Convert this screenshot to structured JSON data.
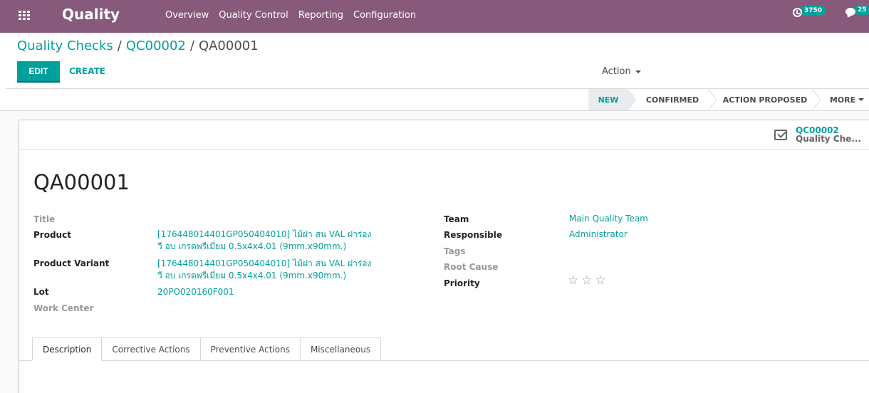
{
  "nav": {
    "brand": "Quality",
    "menu": [
      "Overview",
      "Quality Control",
      "Reporting",
      "Configuration"
    ],
    "activity_count": "3750",
    "message_count": "25"
  },
  "breadcrumb": {
    "root": "Quality Checks",
    "parent": "QC00002",
    "current": "QA00001"
  },
  "buttons": {
    "edit": "EDIT",
    "create": "CREATE",
    "action": "Action"
  },
  "stages": {
    "new": "NEW",
    "confirmed": "CONFIRMED",
    "action_proposed": "ACTION PROPOSED",
    "more": "MORE"
  },
  "smart_button": {
    "ref": "QC00002",
    "label": "Quality Che..."
  },
  "record": {
    "name": "QA00001"
  },
  "left_fields": {
    "title_label": "Title",
    "product_label": "Product",
    "product_value_l1": "[176448014401GP050404010] ไม้ฝา สน VAL ฝาร่อง",
    "product_value_l2": "วี อบ เกรดพรีเมี่ยม 0.5x4x4.01 (9mm.x90mm.)",
    "variant_label": "Product Variant",
    "variant_value_l1": "[176448014401GP050404010] ไม้ฝา สน VAL ฝาร่อง",
    "variant_value_l2": "วี อบ เกรดพรีเมี่ยม 0.5x4x4.01 (9mm.x90mm.)",
    "lot_label": "Lot",
    "lot_value": "20PO020160F001",
    "workcenter_label": "Work Center"
  },
  "right_fields": {
    "team_label": "Team",
    "team_value": "Main Quality Team",
    "responsible_label": "Responsible",
    "responsible_value": "Administrator",
    "tags_label": "Tags",
    "root_cause_label": "Root Cause",
    "priority_label": "Priority",
    "priority_value": 0,
    "priority_max": 3
  },
  "tabs": [
    "Description",
    "Corrective Actions",
    "Preventive Actions",
    "Miscellaneous"
  ],
  "colors": {
    "navbar": "#875a7b",
    "accent": "#00a09d"
  }
}
